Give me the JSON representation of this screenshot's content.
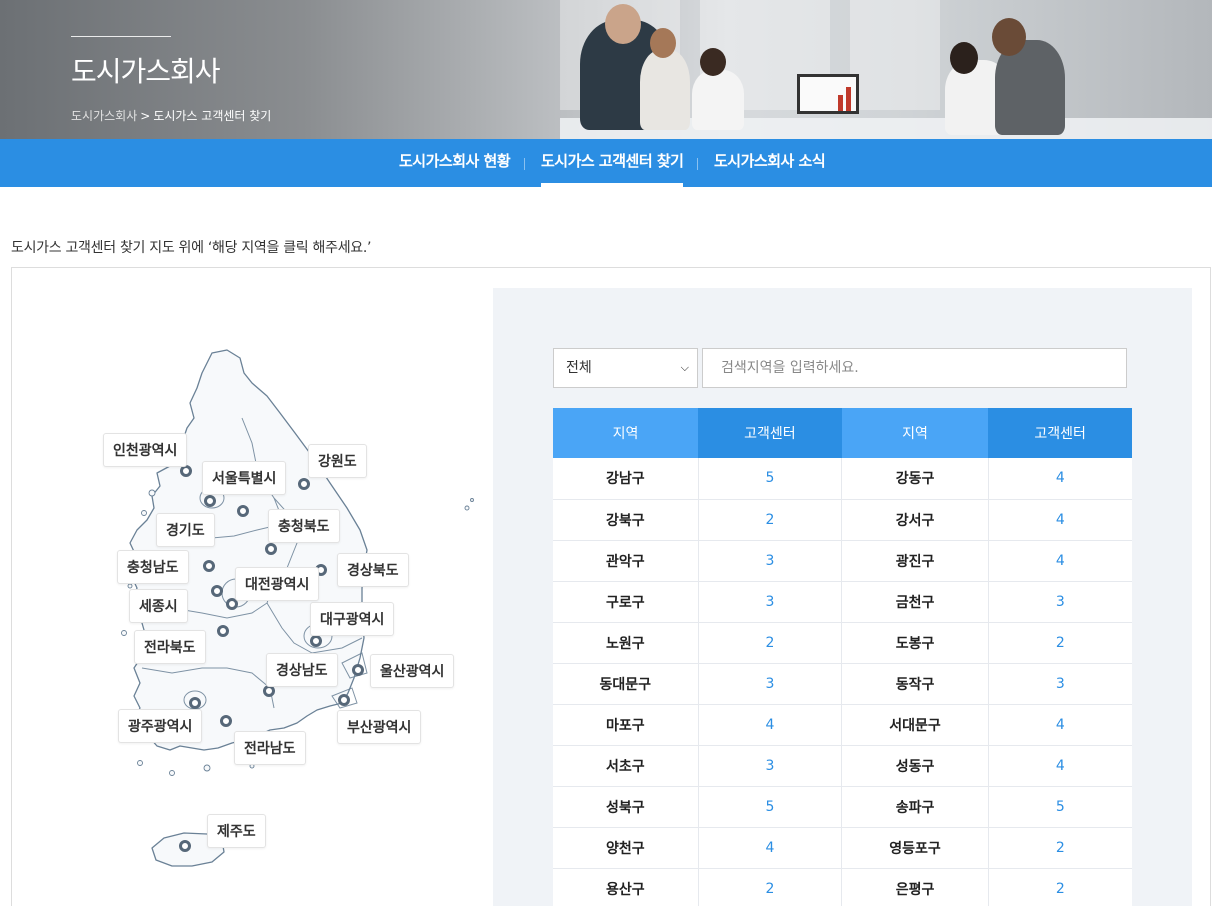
{
  "header": {
    "title": "도시가스회사",
    "breadcrumb": {
      "parent": "도시가스회사",
      "separator": ">",
      "current": "도시가스 고객센터 찾기"
    }
  },
  "nav": {
    "tabs": [
      {
        "label": "도시가스회사 현황",
        "active": false
      },
      {
        "label": "도시가스 고객센터 찾기",
        "active": true
      },
      {
        "label": "도시가스회사 소식",
        "active": false
      }
    ]
  },
  "instruction": "도시가스 고객센터 찾기 지도 위에 ‘해당 지역을 클릭 해주세요.’",
  "map": {
    "regions": [
      {
        "id": "incheon",
        "label": "인천광역시"
      },
      {
        "id": "seoul",
        "label": "서울특별시"
      },
      {
        "id": "gangwon",
        "label": "강원도"
      },
      {
        "id": "gyeonggi",
        "label": "경기도"
      },
      {
        "id": "chungbuk",
        "label": "충청북도"
      },
      {
        "id": "chungnam",
        "label": "충청남도"
      },
      {
        "id": "daejeon",
        "label": "대전광역시"
      },
      {
        "id": "gyeongbuk",
        "label": "경상북도"
      },
      {
        "id": "sejong",
        "label": "세종시"
      },
      {
        "id": "daegu",
        "label": "대구광역시"
      },
      {
        "id": "jeonbuk",
        "label": "전라북도"
      },
      {
        "id": "gyeongnam",
        "label": "경상남도"
      },
      {
        "id": "ulsan",
        "label": "울산광역시"
      },
      {
        "id": "gwangju",
        "label": "광주광역시"
      },
      {
        "id": "busan",
        "label": "부산광역시"
      },
      {
        "id": "jeonnam",
        "label": "전라남도"
      },
      {
        "id": "jeju",
        "label": "제주도"
      }
    ]
  },
  "search": {
    "select_value": "전체",
    "placeholder": "검색지역을 입력하세요."
  },
  "table": {
    "headers": [
      "지역",
      "고객센터",
      "지역",
      "고객센터"
    ],
    "rows": [
      [
        "강남구",
        "5",
        "강동구",
        "4"
      ],
      [
        "강북구",
        "2",
        "강서구",
        "4"
      ],
      [
        "관악구",
        "3",
        "광진구",
        "4"
      ],
      [
        "구로구",
        "3",
        "금천구",
        "3"
      ],
      [
        "노원구",
        "2",
        "도봉구",
        "2"
      ],
      [
        "동대문구",
        "3",
        "동작구",
        "3"
      ],
      [
        "마포구",
        "4",
        "서대문구",
        "4"
      ],
      [
        "서초구",
        "3",
        "성동구",
        "4"
      ],
      [
        "성북구",
        "5",
        "송파구",
        "5"
      ],
      [
        "양천구",
        "4",
        "영등포구",
        "2"
      ],
      [
        "용산구",
        "2",
        "은평구",
        "2"
      ]
    ]
  },
  "colors": {
    "nav_blue": "#2b8ee3",
    "header_light_blue": "#4aa5f6",
    "count_blue": "#2b8ee3",
    "panel_bg": "#f0f3f7",
    "marker": "#576879"
  }
}
